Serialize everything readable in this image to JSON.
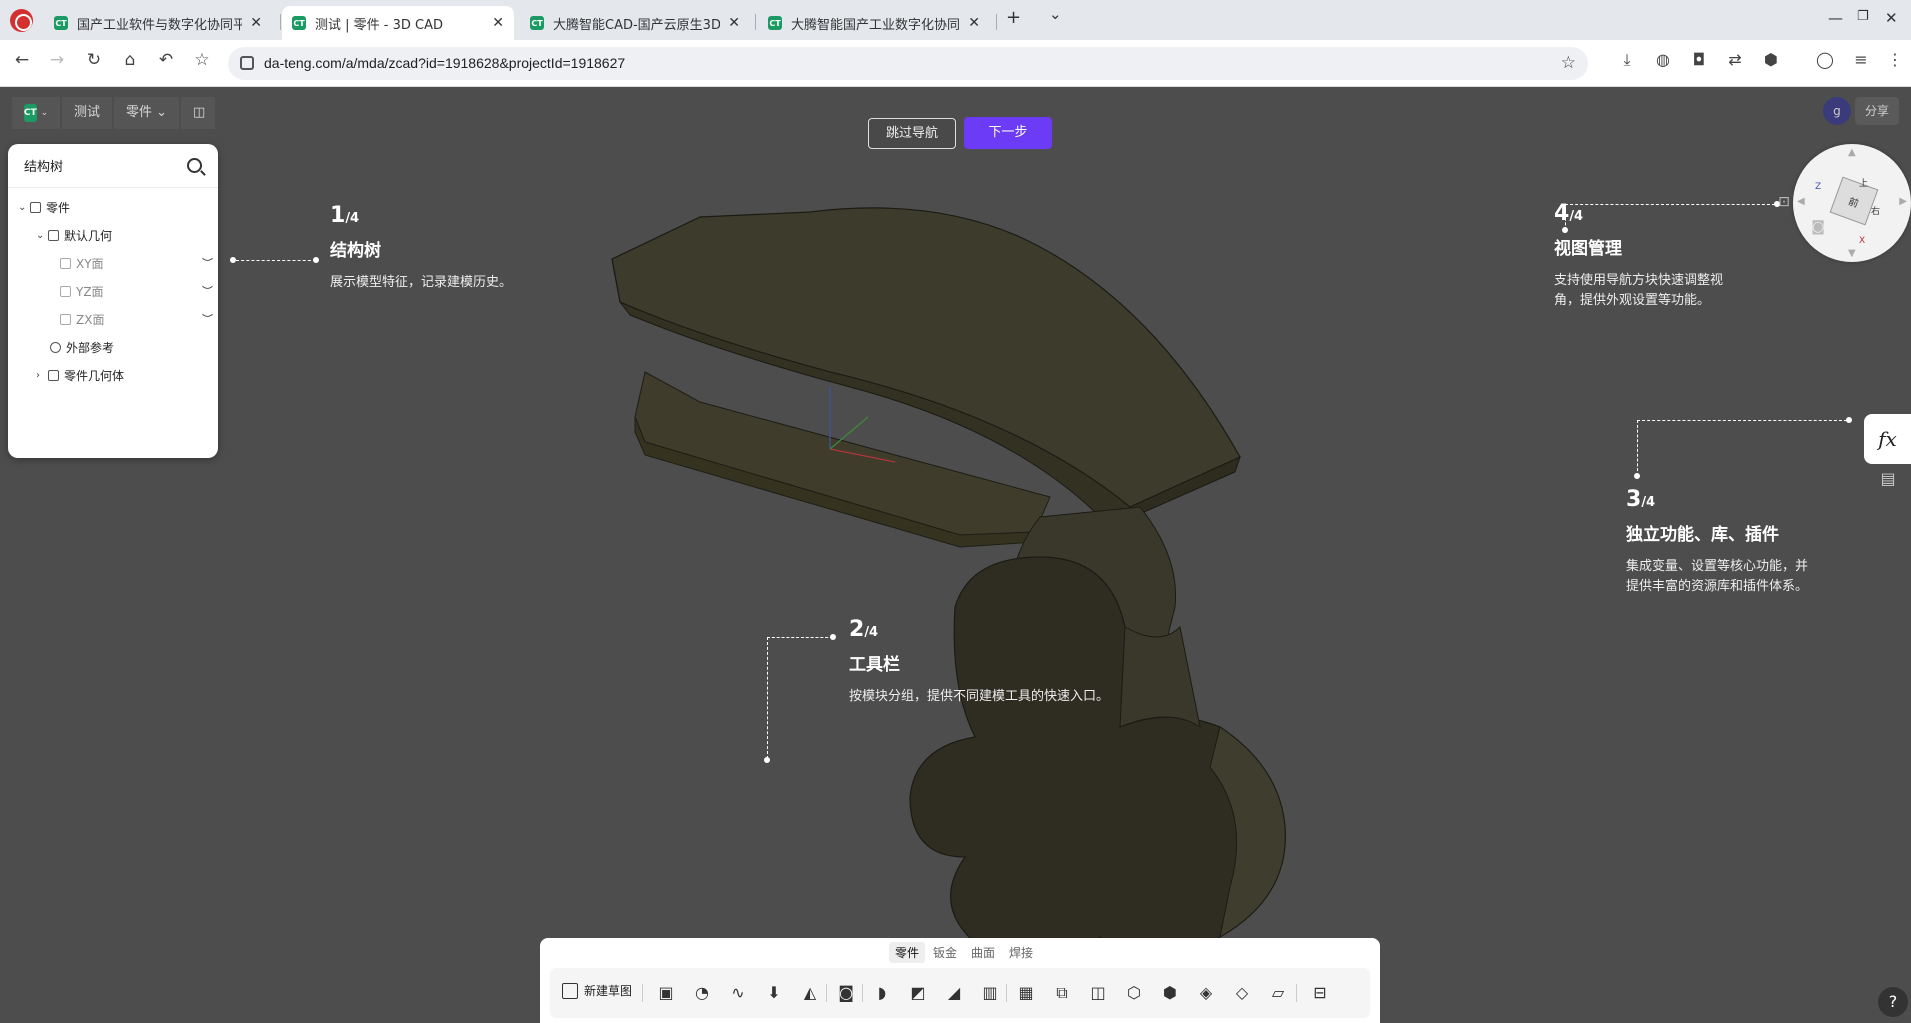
{
  "browser": {
    "tabs": [
      {
        "title": "国产工业软件与数字化协同平",
        "active": false
      },
      {
        "title": "测试 | 零件 - 3D CAD",
        "active": true
      },
      {
        "title": "大腾智能CAD-国产云原生3D",
        "active": false
      },
      {
        "title": "大腾智能国产工业数字化协同",
        "active": false
      }
    ],
    "new_tab": "+",
    "tab_list": "⌄",
    "url": "da-teng.com/a/mda/zcad?id=1918628&projectId=1918627"
  },
  "app": {
    "logo_mark": "CT",
    "breadcrumb_project": "测试",
    "breadcrumb_type": "零件 ⌄",
    "share_label": "分享",
    "user_initial": "g"
  },
  "tree": {
    "title": "结构树",
    "rows": [
      {
        "label": "零件",
        "caret": "⌄"
      },
      {
        "label": "默认几何",
        "caret": "⌄"
      },
      {
        "label": "XY面",
        "caret": ""
      },
      {
        "label": "YZ面",
        "caret": ""
      },
      {
        "label": "ZX面",
        "caret": ""
      },
      {
        "label": "外部参考",
        "caret": ""
      },
      {
        "label": "零件几何体",
        "caret": "›"
      }
    ],
    "eye_glyph": "︶"
  },
  "guide": {
    "skip_label": "跳过导航",
    "next_label": "下一步",
    "total": "/4",
    "steps": [
      {
        "num": "1",
        "title": "结构树",
        "desc": "展示模型特征，记录建模历史。"
      },
      {
        "num": "2",
        "title": "工具栏",
        "desc": "按模块分组，提供不同建模工具的快速入口。"
      },
      {
        "num": "3",
        "title": "独立功能、库、插件",
        "desc_line1": "集成变量、设置等核心功能，并",
        "desc_line2": "提供丰富的资源库和插件体系。"
      },
      {
        "num": "4",
        "title": "视图管理",
        "desc_line1": "支持使用导航方块快速调整视",
        "desc_line2": "角，提供外观设置等功能。"
      }
    ]
  },
  "nav_cube": {
    "face_label": "前",
    "side_label": "右",
    "top_label": "上",
    "axis_z": "Z",
    "axis_x": "X"
  },
  "side": {
    "fx_label": "fx"
  },
  "toolbar": {
    "tabs": [
      "零件",
      "钣金",
      "曲面",
      "焊接"
    ],
    "new_sketch_label": "新建草图"
  },
  "help": {
    "label": "?"
  },
  "colors": {
    "accent": "#6b3bf5",
    "brand": "#1b9a63",
    "model": "#3d3b2c"
  }
}
